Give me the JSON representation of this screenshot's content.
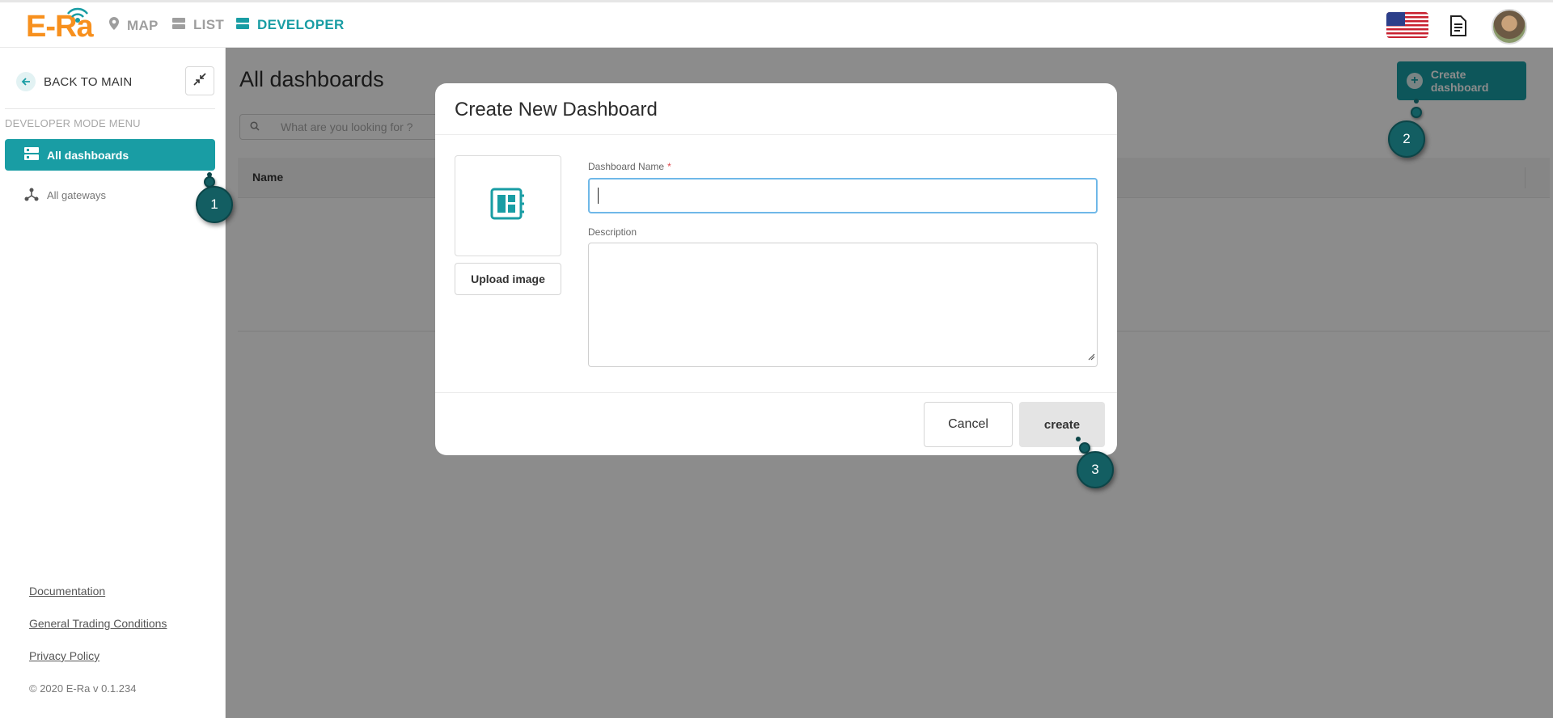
{
  "header": {
    "logo_text": "E-Ra",
    "nav": [
      {
        "label": "MAP",
        "icon": "map-pin-icon",
        "active": false
      },
      {
        "label": "LIST",
        "icon": "list-icon",
        "active": false
      },
      {
        "label": "DEVELOPER",
        "icon": "developer-icon",
        "active": true
      }
    ],
    "language_flag": "us-flag-icon",
    "accent_color": "#199da4",
    "logo_color": "#f7901e"
  },
  "sidebar": {
    "back_label": "BACK TO MAIN",
    "menu_title": "DEVELOPER MODE MENU",
    "items": [
      {
        "label": "All dashboards",
        "icon": "dashboards-icon",
        "active": true
      },
      {
        "label": "All gateways",
        "icon": "gateway-icon",
        "active": false
      }
    ],
    "links": [
      {
        "label": "Documentation"
      },
      {
        "label": "General Trading Conditions"
      },
      {
        "label": "Privacy Policy"
      }
    ],
    "copyright": "© 2020 E-Ra v 0.1.234"
  },
  "main": {
    "title": "All dashboards",
    "search_placeholder": "What are you looking for ?",
    "create_button_label": "Create dashboard",
    "table_columns": [
      "Name"
    ]
  },
  "modal": {
    "title": "Create New Dashboard",
    "upload_label": "Upload image",
    "name_label": "Dashboard Name",
    "name_required_mark": "*",
    "name_value": "",
    "description_label": "Description",
    "description_value": "",
    "cancel_label": "Cancel",
    "create_label": "create"
  },
  "steps": [
    "1",
    "2",
    "3"
  ]
}
